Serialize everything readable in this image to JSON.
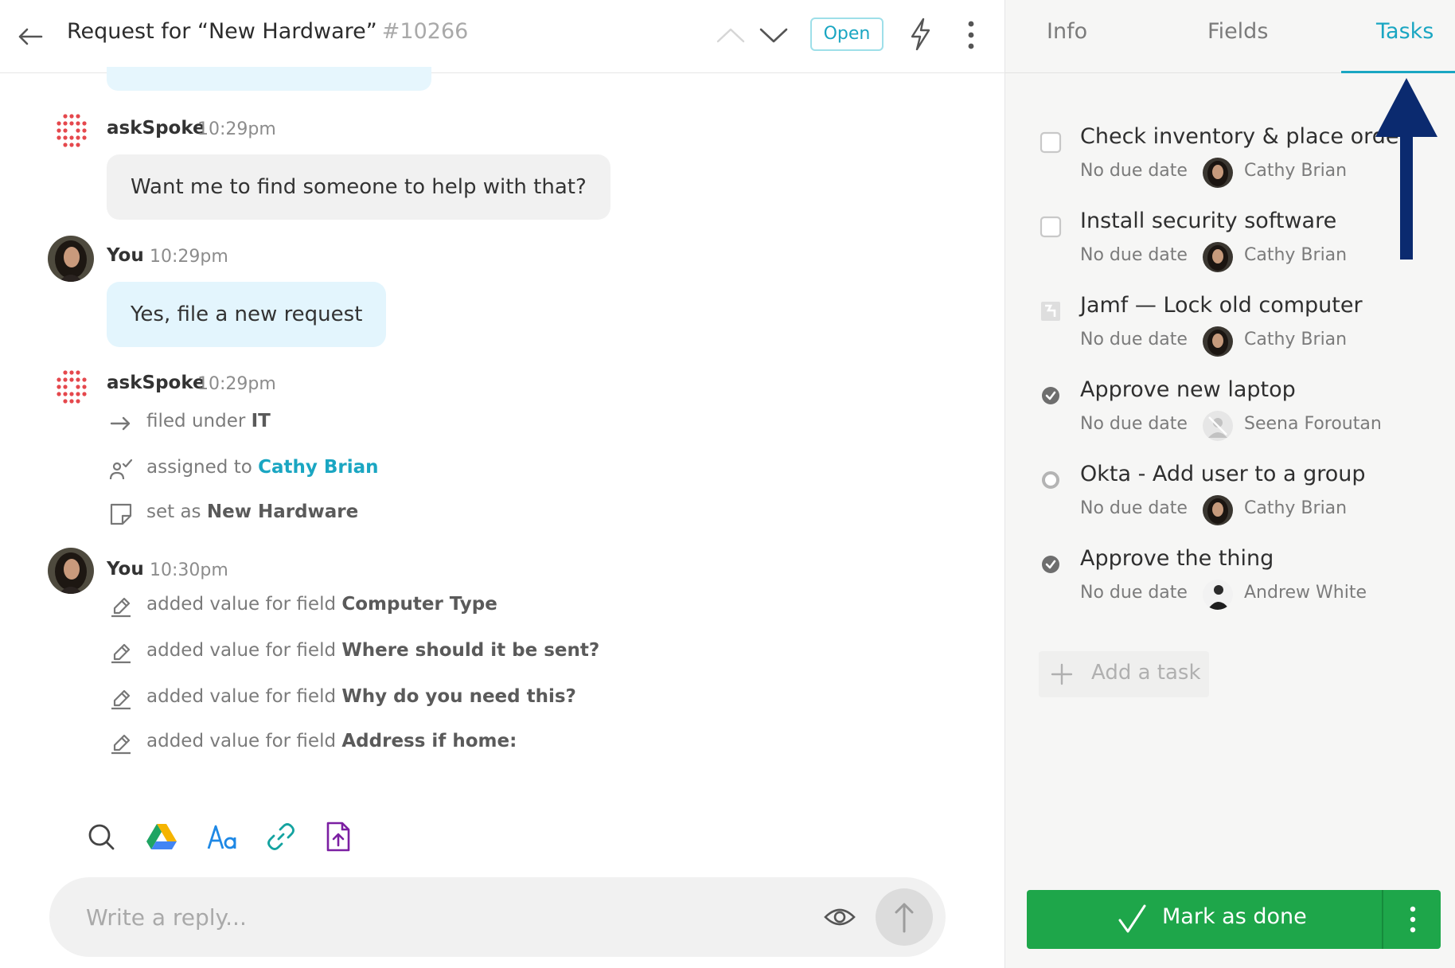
{
  "header": {
    "title": "Request for “New Hardware”",
    "number": "#10266",
    "status": "Open"
  },
  "tabs": {
    "info": "Info",
    "fields": "Fields",
    "tasks": "Tasks",
    "active": "Tasks"
  },
  "messages": [
    {
      "sender": "askSpoke",
      "time": "10:29pm",
      "text": "Want me to find someone to help with that?"
    },
    {
      "sender": "You",
      "time": "10:29pm",
      "text": "Yes, file a new request"
    }
  ],
  "bot_update": {
    "sender": "askSpoke",
    "time": "10:29pm",
    "filed_prefix": "filed under",
    "filed_value": "IT",
    "assigned_prefix": "assigned to",
    "assigned_value": "Cathy Brian",
    "set_prefix": "set as",
    "set_value": "New Hardware"
  },
  "field_updates": {
    "sender": "You",
    "time": "10:30pm",
    "prefix": "added value for field",
    "fields": [
      "Computer Type",
      "Where should it be sent?",
      "Why do you need this?",
      "Address if home:"
    ]
  },
  "composer": {
    "placeholder": "Write a reply...",
    "tools": [
      "search-icon",
      "google-drive-icon",
      "text-format-icon",
      "link-icon",
      "file-upload-icon"
    ]
  },
  "tasks": [
    {
      "title": "Check inventory & place order",
      "due": "No due date",
      "assignee": "Cathy Brian",
      "state": "open"
    },
    {
      "title": "Install security software",
      "due": "No due date",
      "assignee": "Cathy Brian",
      "state": "open"
    },
    {
      "title": "Jamf — Lock old computer",
      "due": "No due date",
      "assignee": "Cathy Brian",
      "state": "integration"
    },
    {
      "title": "Approve new laptop",
      "due": "No due date",
      "assignee": "Seena Foroutan",
      "state": "approved"
    },
    {
      "title": "Okta - Add user to a group",
      "due": "No due date",
      "assignee": "Cathy Brian",
      "state": "pending"
    },
    {
      "title": "Approve the thing",
      "due": "No due date",
      "assignee": "Andrew White",
      "state": "approved"
    }
  ],
  "add_task_label": "Add a task",
  "mark_done_label": "Mark as done",
  "colors": {
    "accent": "#1aa6c2",
    "done_green": "#1ea64a",
    "arrow_navy": "#0b2a6f",
    "spoke_red": "#e5484d"
  }
}
